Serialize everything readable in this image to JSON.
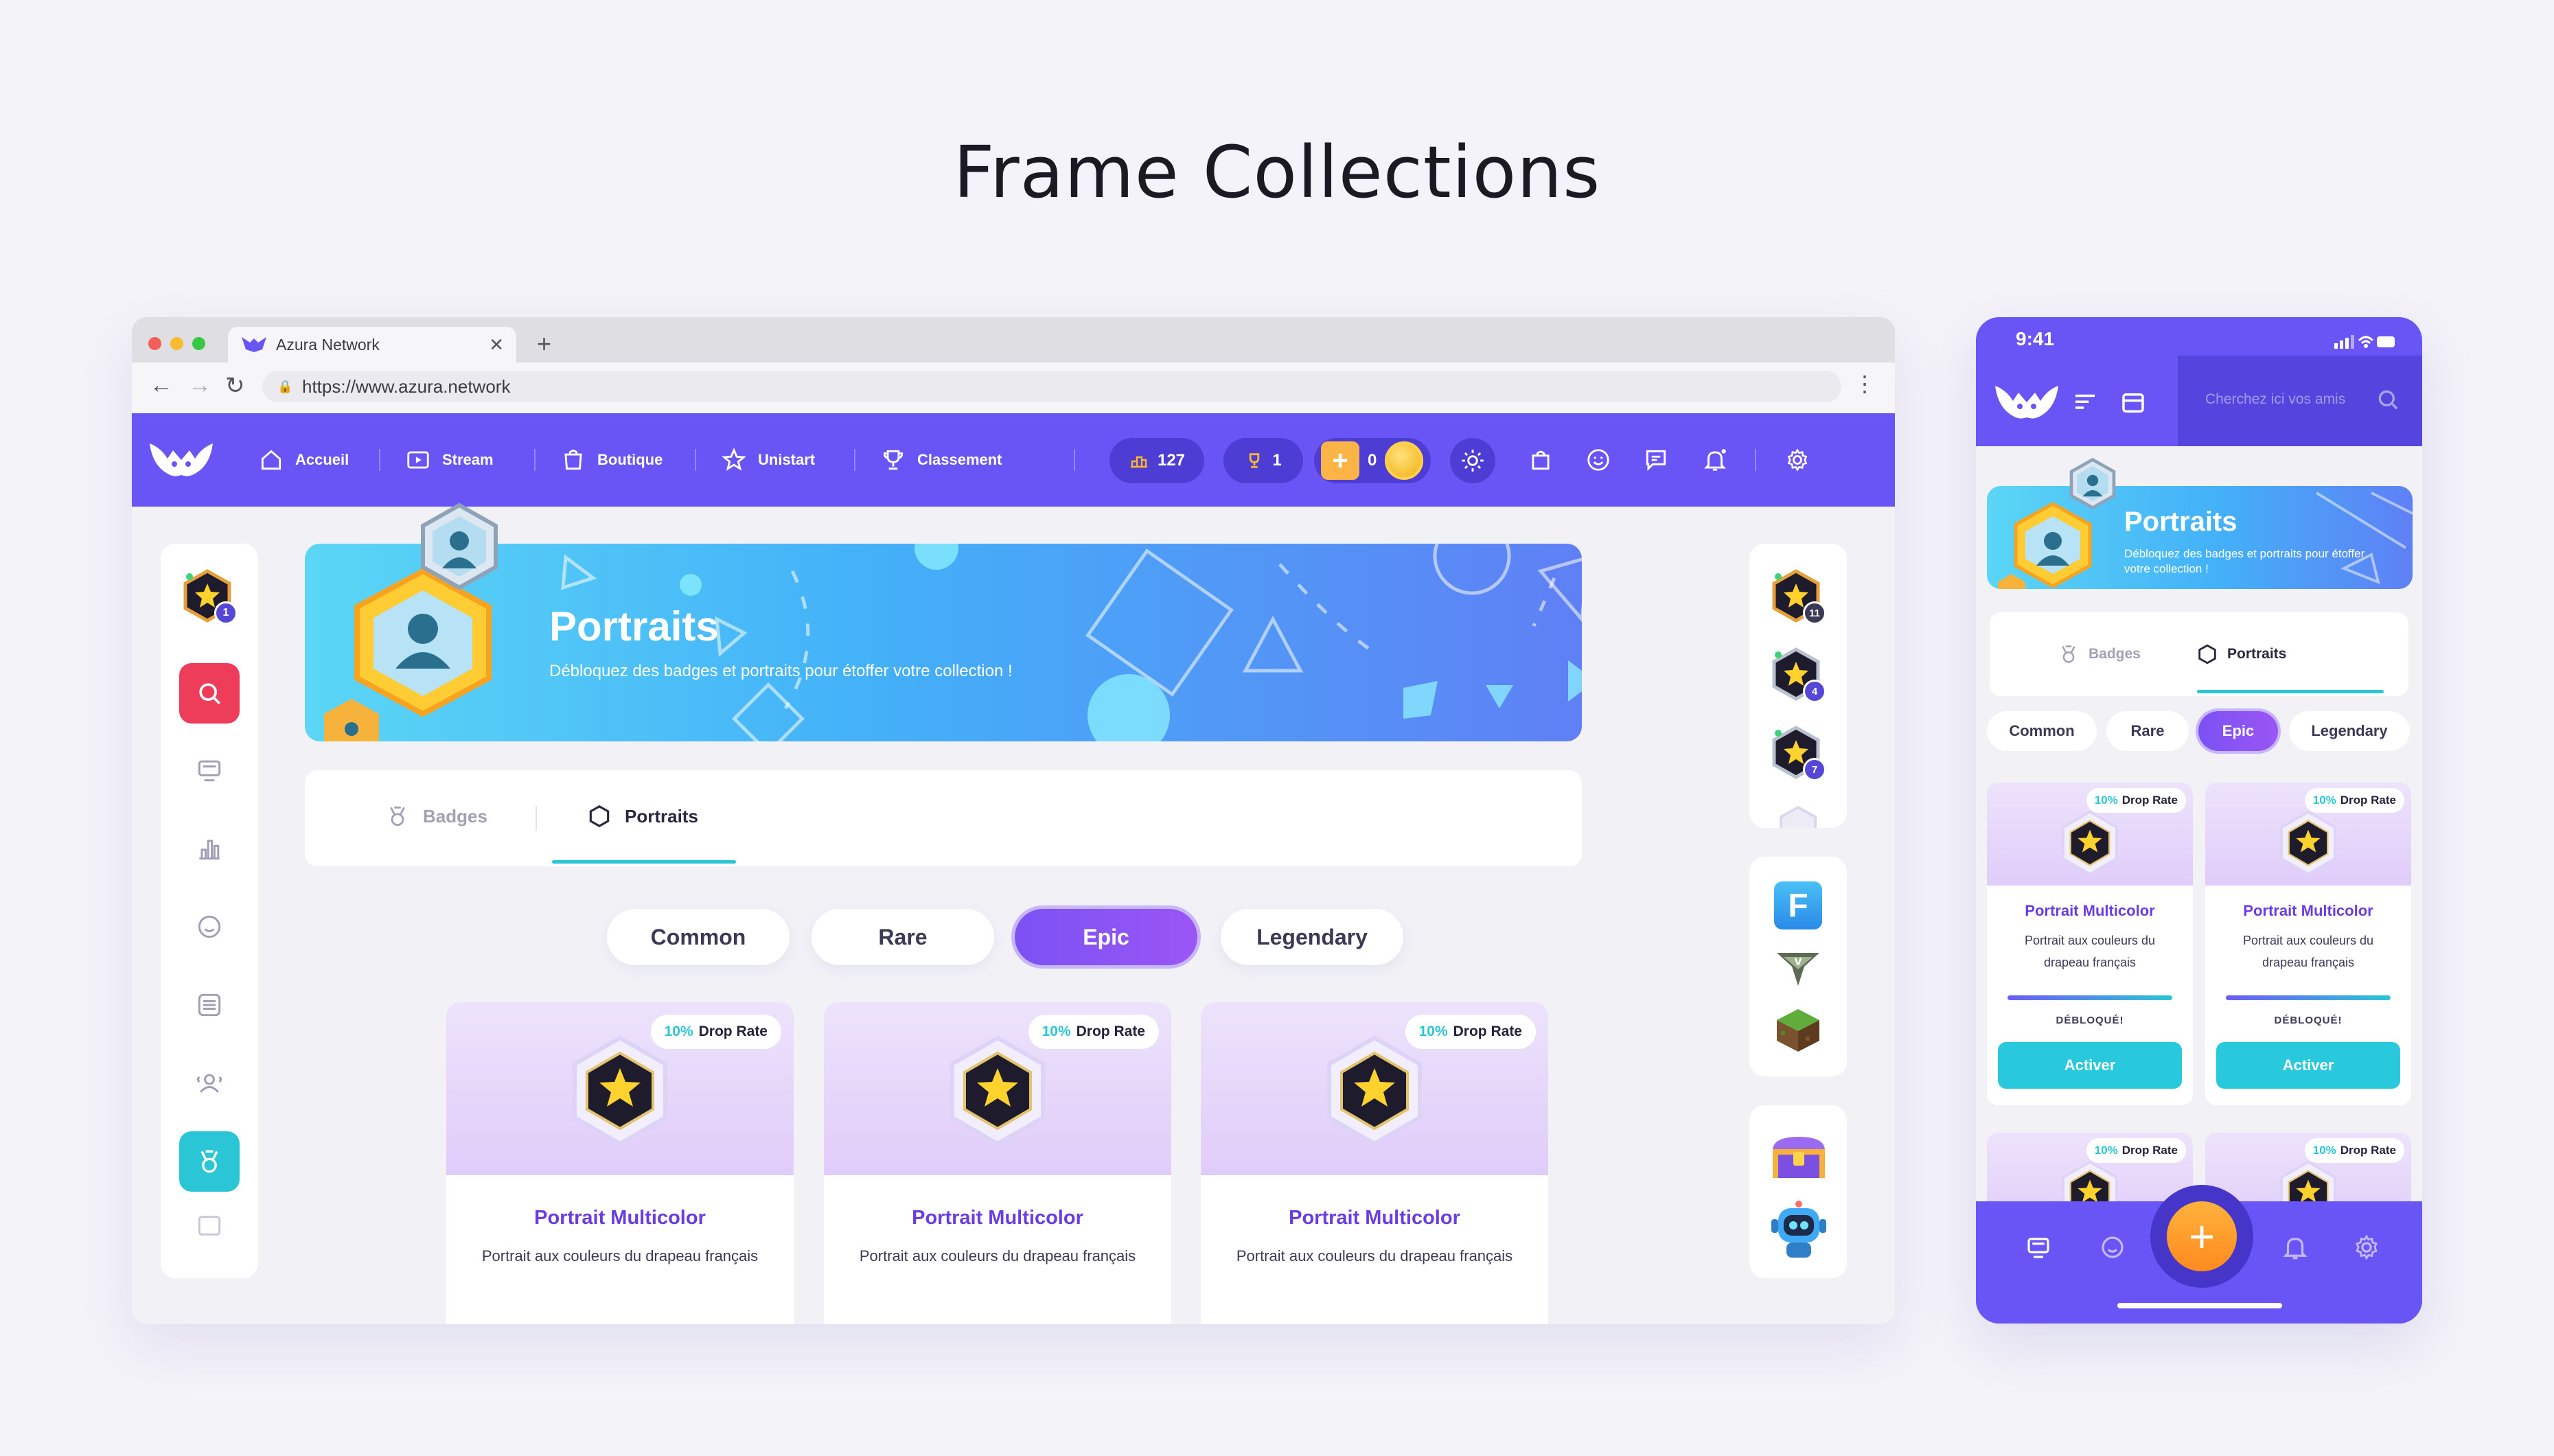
{
  "page": {
    "title": "Frame Collections"
  },
  "browser": {
    "tab_title": "Azura Network",
    "tab_close": "✕",
    "new_tab": "+",
    "url": "https://www.azura.network"
  },
  "app_nav": {
    "items": [
      "Accueil",
      "Stream",
      "Boutique",
      "Unistart",
      "Classement"
    ],
    "coins": "127",
    "trophies": "1",
    "boost": "0"
  },
  "banner": {
    "title": "Portraits",
    "subtitle": "Débloquez des badges et portraits pour étoffer votre collection !"
  },
  "tabs": {
    "badges": "Badges",
    "portraits": "Portraits",
    "active": "portraits"
  },
  "rarity_filters": [
    "Common",
    "Rare",
    "Epic",
    "Legendary"
  ],
  "rarity_active": "Epic",
  "badge_levels": {
    "left": "1",
    "right": [
      "11",
      "4",
      "7"
    ]
  },
  "cards": [
    {
      "drop_pct": "10%",
      "drop_label": "Drop Rate",
      "name": "Portrait Multicolor",
      "desc": "Portrait aux couleurs du drapeau français"
    },
    {
      "drop_pct": "10%",
      "drop_label": "Drop Rate",
      "name": "Portrait Multicolor",
      "desc": "Portrait aux couleurs du drapeau français"
    },
    {
      "drop_pct": "10%",
      "drop_label": "Drop Rate",
      "name": "Portrait Multicolor",
      "desc": "Portrait aux couleurs du drapeau français"
    }
  ],
  "mobile": {
    "time": "9:41",
    "search_placeholder": "Cherchez ici vos amis",
    "banner_title": "Portraits",
    "banner_subtitle": "Débloquez des badges et portraits pour étoffer votre collection !",
    "tabs": {
      "badges": "Badges",
      "portraits": "Portraits"
    },
    "filters": [
      "Common",
      "Rare",
      "Epic",
      "Legendary"
    ],
    "cards": [
      {
        "drop_pct": "10%",
        "drop_label": "Drop Rate",
        "name": "Portrait Multicolor",
        "desc": "Portrait aux couleurs du drapeau français",
        "status": "DÉBLOQUÉ!",
        "action": "Activer"
      },
      {
        "drop_pct": "10%",
        "drop_label": "Drop Rate",
        "name": "Portrait Multicolor",
        "desc": "Portrait aux couleurs du drapeau français",
        "status": "DÉBLOQUÉ!",
        "action": "Activer"
      },
      {
        "drop_pct": "10%",
        "drop_label": "Drop Rate"
      },
      {
        "drop_pct": "10%",
        "drop_label": "Drop Rate"
      }
    ],
    "fab": "+"
  },
  "colors": {
    "brand": "#6954F6",
    "accent": "#2BC6D6",
    "epic": "#7B52F3",
    "danger": "#EE3D5A",
    "card_name": "#6A3DE3"
  },
  "icons": [
    "home-icon",
    "stream-icon",
    "shop-icon",
    "star-icon",
    "trophy-icon",
    "sun-icon",
    "bag-icon",
    "smile-icon",
    "chat-icon",
    "bell-icon",
    "gear-icon",
    "search-icon",
    "monitor-icon",
    "chart-icon",
    "list-icon",
    "users-icon",
    "medal-icon",
    "hexagon-icon"
  ]
}
